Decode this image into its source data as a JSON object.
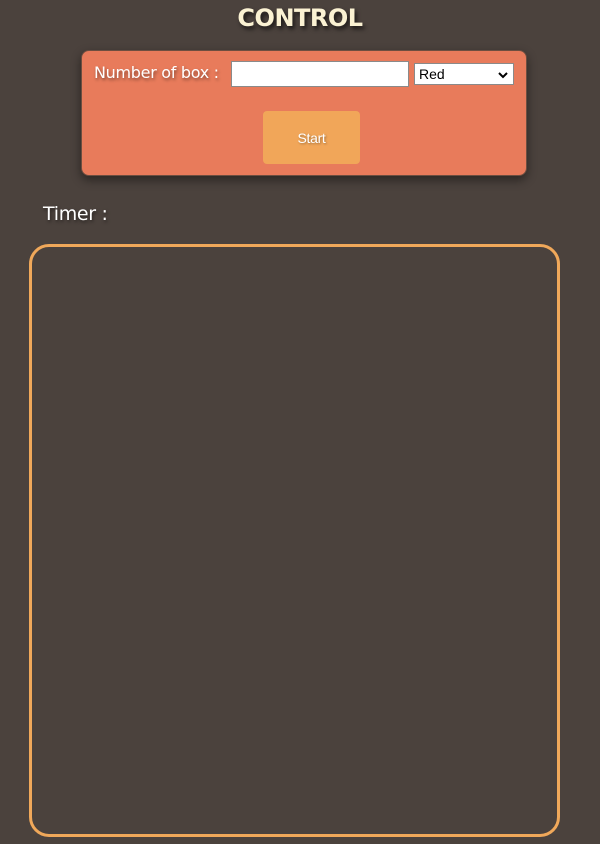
{
  "header": {
    "title": "CONTROL"
  },
  "controls": {
    "box_label": "Number of box :",
    "box_input_value": "",
    "box_input_placeholder": "",
    "color_select_value": "Red",
    "start_label": "Start"
  },
  "timer": {
    "label": "Timer :",
    "value": ""
  },
  "colors": {
    "background": "#4b423d",
    "panel": "#e87b5b",
    "button": "#f1a659",
    "play_area_border": "#f0a85a",
    "title": "#fbf2d3"
  },
  "icons": {
    "select_arrow": "chevron-down-icon"
  }
}
